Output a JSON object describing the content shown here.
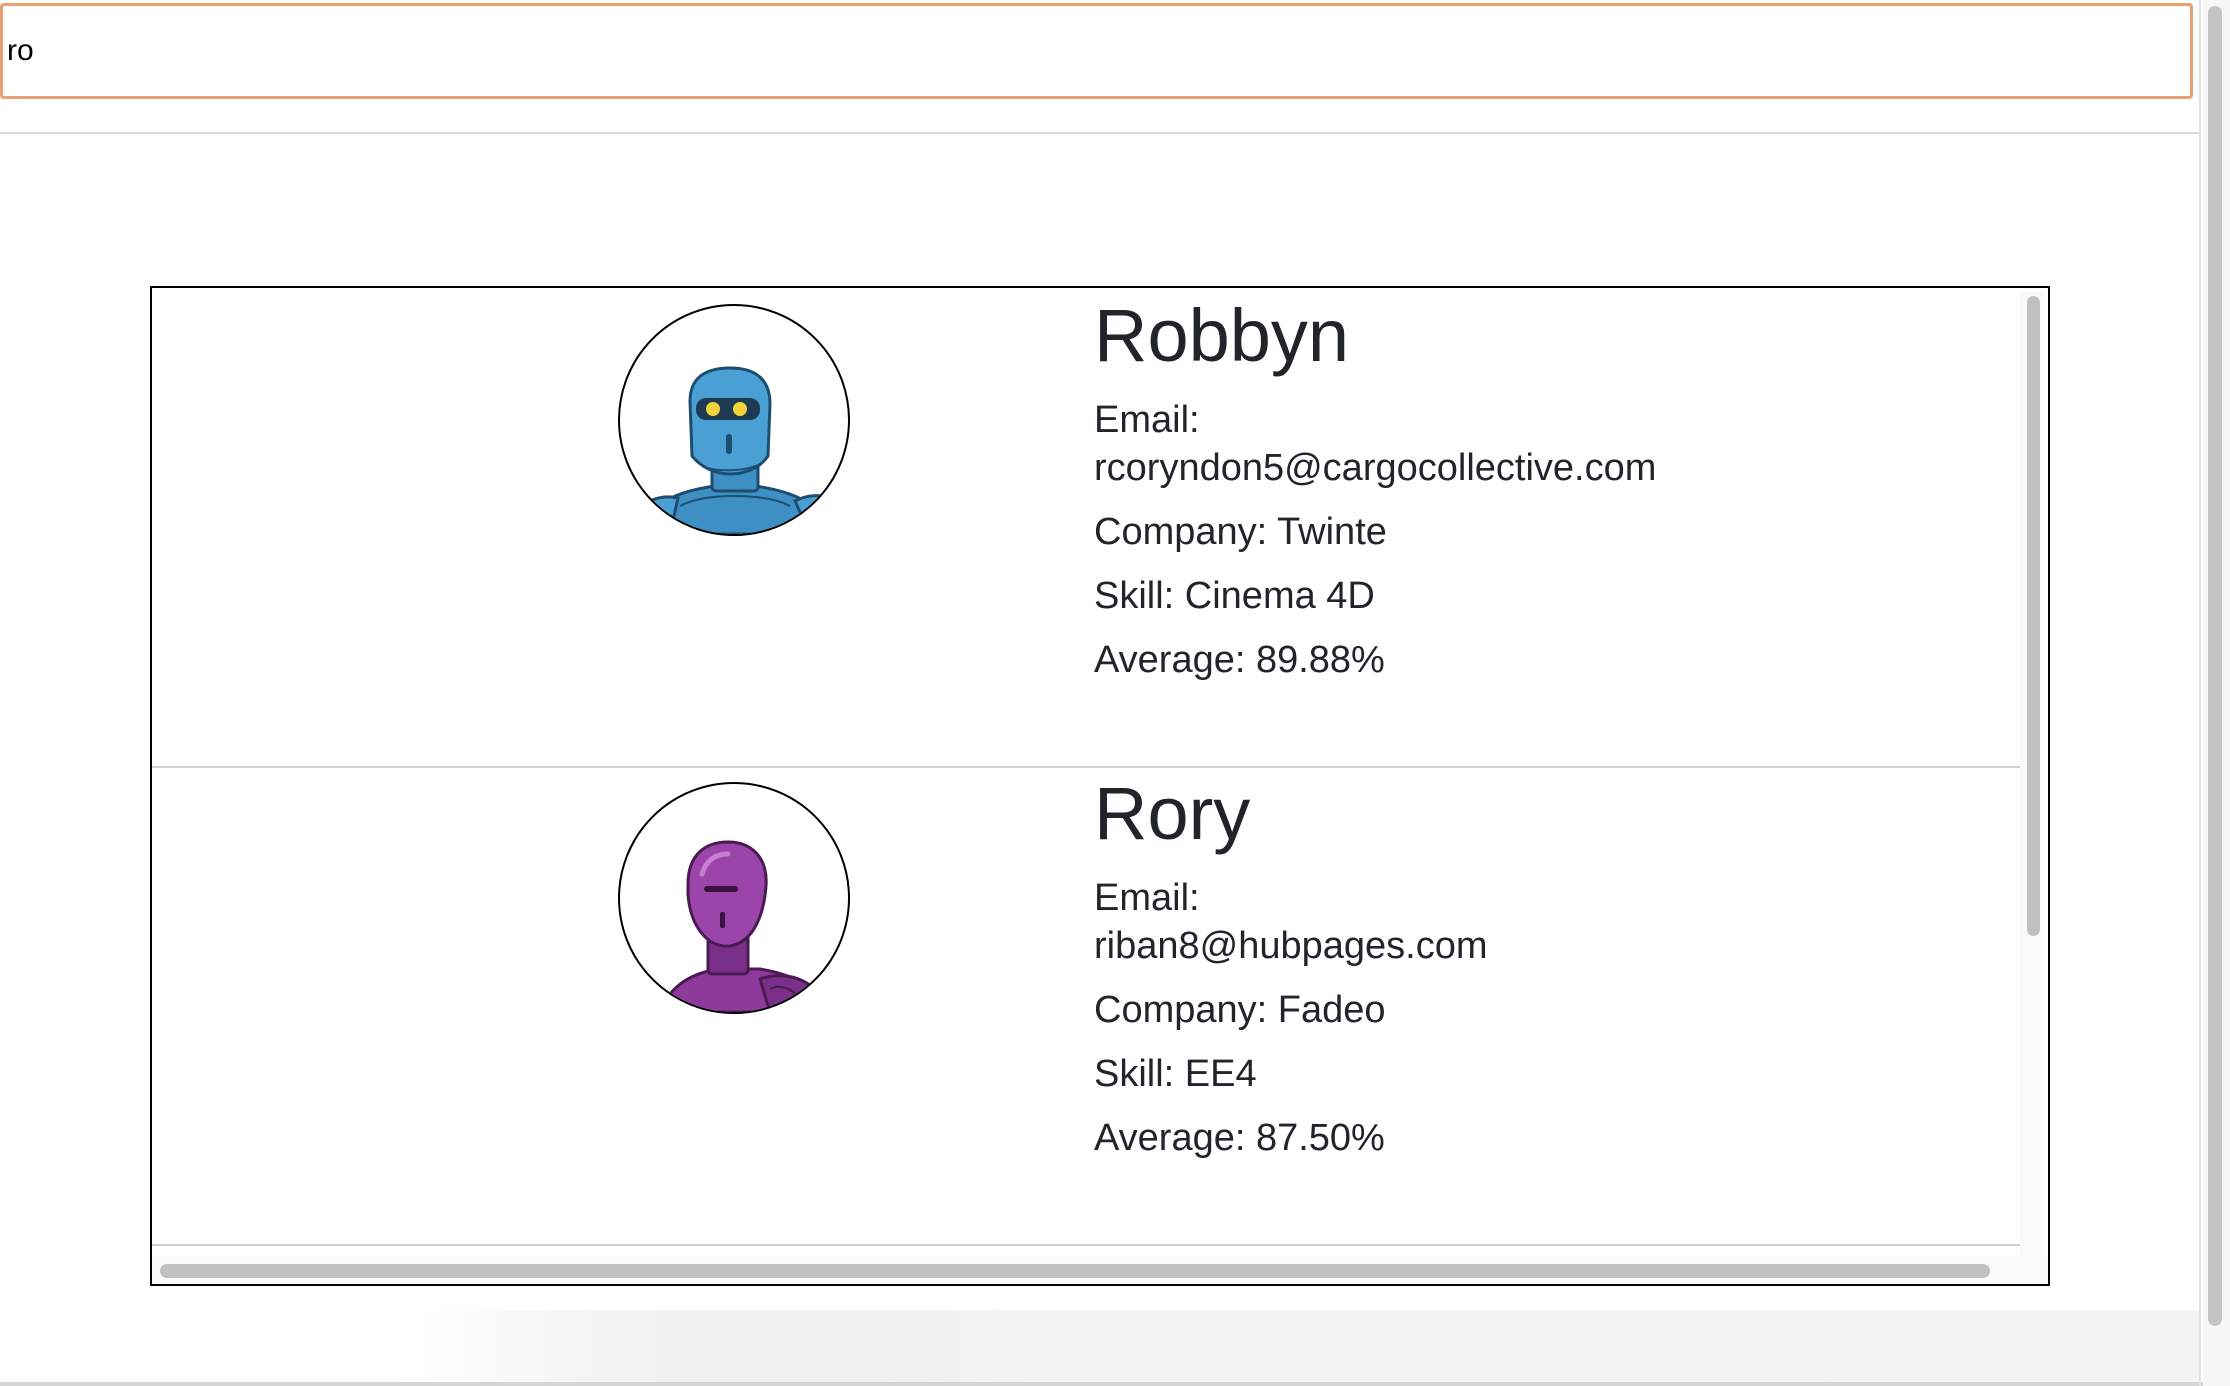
{
  "search": {
    "value": "ro",
    "placeholder": ""
  },
  "results": [
    {
      "name": "Robbyn",
      "email_label": "Email:",
      "email": "rcoryndon5@cargocollective.com",
      "company_text": "Company: Twinte",
      "skill_text": "Skill: Cinema 4D",
      "average_text": "Average: 89.88%",
      "avatar": {
        "icon": "robot-avatar-icon",
        "color": "#4a9fd4"
      }
    },
    {
      "name": "Rory",
      "email_label": "Email:",
      "email": "riban8@hubpages.com",
      "company_text": "Company: Fadeo",
      "skill_text": "Skill: EE4",
      "average_text": "Average: 87.50%",
      "avatar": {
        "icon": "robot-avatar-icon",
        "color": "#8e3a9d"
      }
    }
  ],
  "colors": {
    "search_border": "#e8a070",
    "text": "#212529",
    "list_border": "#000000"
  }
}
